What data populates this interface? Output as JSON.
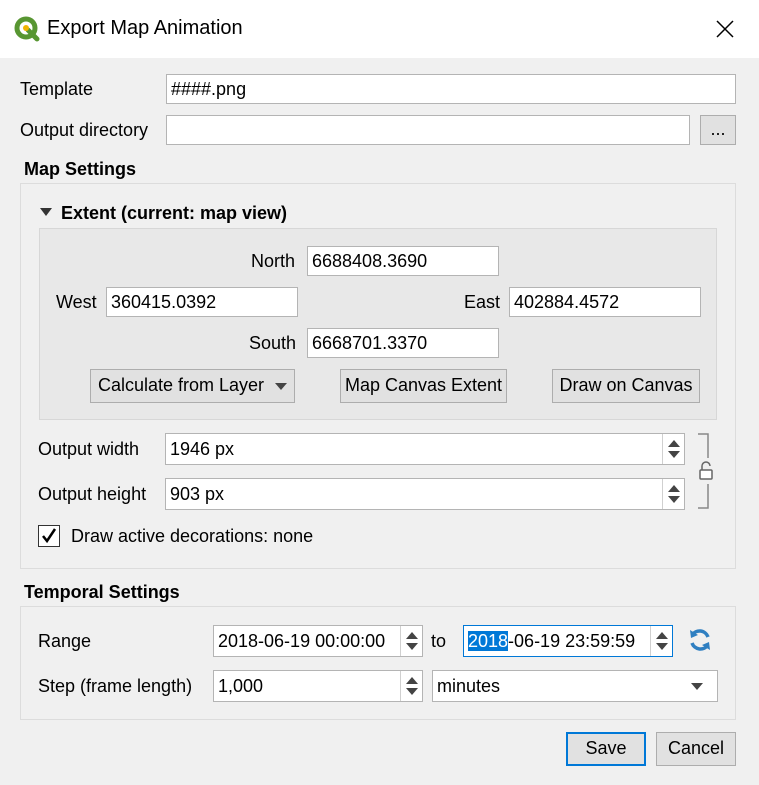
{
  "window": {
    "title": "Export Map Animation"
  },
  "template": {
    "label": "Template",
    "value": "####.png"
  },
  "output_directory": {
    "label": "Output directory",
    "value": "",
    "browse_label": "..."
  },
  "map_settings": {
    "title": "Map Settings",
    "extent": {
      "title": "Extent (current: map view)",
      "north_label": "North",
      "north_value": "6688408.3690",
      "west_label": "West",
      "west_value": "360415.0392",
      "east_label": "East",
      "east_value": "402884.4572",
      "south_label": "South",
      "south_value": "6668701.3370",
      "calc_from_layer": "Calculate from Layer",
      "map_canvas_extent": "Map Canvas Extent",
      "draw_on_canvas": "Draw on Canvas"
    },
    "output_width": {
      "label": "Output width",
      "value": "1946 px"
    },
    "output_height": {
      "label": "Output height",
      "value": "903 px"
    },
    "draw_decorations": {
      "label": "Draw active decorations: none",
      "checked": true
    }
  },
  "temporal_settings": {
    "title": "Temporal Settings",
    "range_label": "Range",
    "range_start": "2018-06-19 00:00:00",
    "to_label": "to",
    "range_end_selected": "2018",
    "range_end_rest": "-06-19 23:59:59",
    "step_label": "Step (frame length)",
    "step_value": "1,000",
    "step_unit": "minutes"
  },
  "buttons": {
    "save": "Save",
    "cancel": "Cancel"
  },
  "colors": {
    "accent": "#0078d7",
    "qgis_green": "#589632"
  }
}
